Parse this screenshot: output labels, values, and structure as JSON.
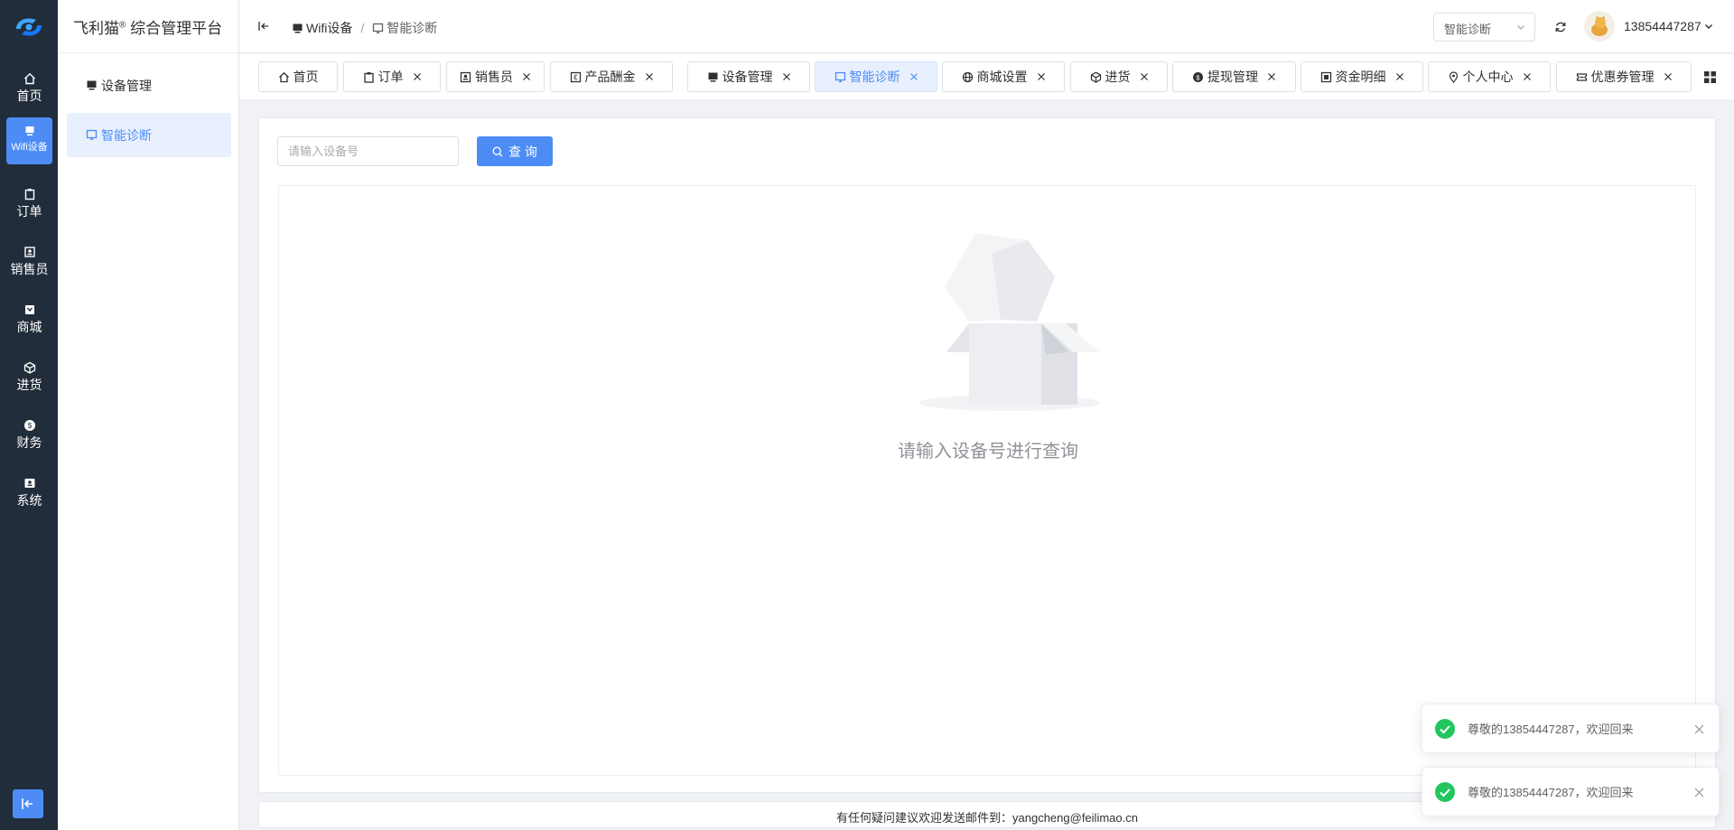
{
  "colors": {
    "primary": "#4d8cf5",
    "rail_bg": "#222d3c",
    "success": "#22c55e"
  },
  "rail": {
    "items": [
      {
        "label": "首页",
        "icon": "home-icon"
      },
      {
        "label": "Wifi设备",
        "icon": "monitor-icon"
      },
      {
        "label": "订单",
        "icon": "clipboard-icon"
      },
      {
        "label": "销售员",
        "icon": "badge-icon"
      },
      {
        "label": "商城",
        "icon": "shop-icon"
      },
      {
        "label": "进货",
        "icon": "cube-icon"
      },
      {
        "label": "财务",
        "icon": "coin-icon"
      },
      {
        "label": "系统",
        "icon": "system-icon"
      }
    ]
  },
  "brand": {
    "name": "飞利猫",
    "mark": "®",
    "suffix": " 综合管理平台"
  },
  "sidebar": {
    "items": [
      {
        "label": "设备管理",
        "icon": "monitor-icon"
      },
      {
        "label": "智能诊断",
        "icon": "screen-icon"
      }
    ]
  },
  "header": {
    "breadcrumb": [
      {
        "label": "Wifi设备"
      },
      {
        "label": "智能诊断"
      }
    ],
    "breadcrumb_sep": "/",
    "nav_select": "智能诊断",
    "username": "13854447287"
  },
  "tabs": [
    {
      "label": "首页",
      "icon": "home-icon"
    },
    {
      "label": "订单",
      "icon": "clipboard-icon"
    },
    {
      "label": "销售员",
      "icon": "badge-icon"
    },
    {
      "label": "产品酬金",
      "icon": "euro-icon"
    },
    {
      "label": "设备管理",
      "icon": "monitor-icon"
    },
    {
      "label": "智能诊断",
      "icon": "screen-icon"
    },
    {
      "label": "商城设置",
      "icon": "globe-icon"
    },
    {
      "label": "进货",
      "icon": "cube-icon"
    },
    {
      "label": "提现管理",
      "icon": "coin-icon"
    },
    {
      "label": "资金明细",
      "icon": "wallet-icon"
    },
    {
      "label": "个人中心",
      "icon": "location-icon"
    },
    {
      "label": "优惠券管理",
      "icon": "ticket-icon"
    }
  ],
  "main": {
    "search_placeholder": "请输入设备号",
    "search_value": "",
    "query_label": "查 询",
    "empty_text": "请输入设备号进行查询"
  },
  "footer": {
    "text": "有任何疑问建议欢迎发送邮件到：yangcheng@feilimao.cn"
  },
  "notifications": [
    {
      "text": "尊敬的13854447287，欢迎回来"
    },
    {
      "text": "尊敬的13854447287，欢迎回来"
    }
  ]
}
